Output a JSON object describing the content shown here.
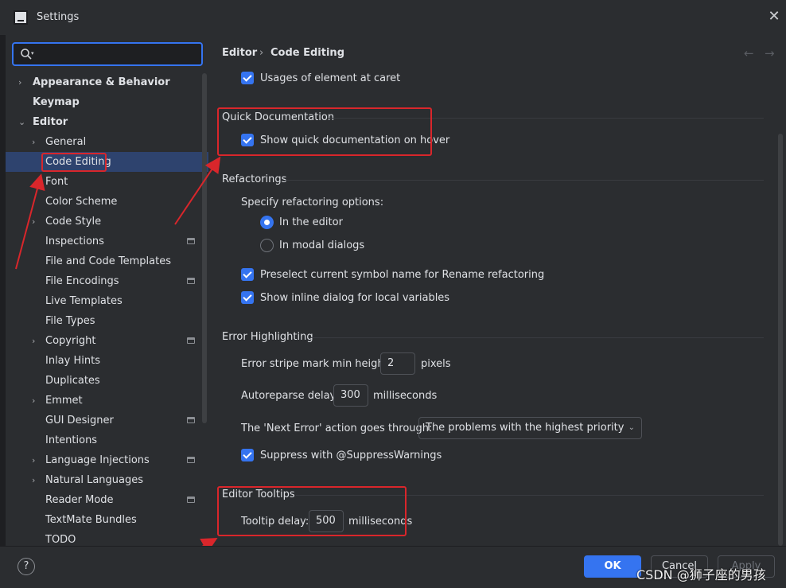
{
  "window": {
    "title": "Settings"
  },
  "sidebar": {
    "search_placeholder": "",
    "items": [
      {
        "label": "Appearance & Behavior"
      },
      {
        "label": "Keymap"
      },
      {
        "label": "Editor"
      },
      {
        "label": "General"
      },
      {
        "label": "Code Editing"
      },
      {
        "label": "Font"
      },
      {
        "label": "Color Scheme"
      },
      {
        "label": "Code Style"
      },
      {
        "label": "Inspections"
      },
      {
        "label": "File and Code Templates"
      },
      {
        "label": "File Encodings"
      },
      {
        "label": "Live Templates"
      },
      {
        "label": "File Types"
      },
      {
        "label": "Copyright"
      },
      {
        "label": "Inlay Hints"
      },
      {
        "label": "Duplicates"
      },
      {
        "label": "Emmet"
      },
      {
        "label": "GUI Designer"
      },
      {
        "label": "Intentions"
      },
      {
        "label": "Language Injections"
      },
      {
        "label": "Natural Languages"
      },
      {
        "label": "Reader Mode"
      },
      {
        "label": "TextMate Bundles"
      },
      {
        "label": "TODO"
      }
    ]
  },
  "breadcrumb": {
    "parent": "Editor",
    "separator": "›",
    "current": "Code Editing"
  },
  "nav": {
    "back": "←",
    "forward": "→"
  },
  "main": {
    "usages_at_caret": {
      "label": "Usages of element at caret",
      "checked": true
    },
    "quick_doc": {
      "title": "Quick Documentation",
      "show_on_hover": {
        "label": "Show quick documentation on hover",
        "checked": true
      }
    },
    "refactorings": {
      "title": "Refactorings",
      "specify_label": "Specify refactoring options:",
      "in_editor": {
        "label": "In the editor",
        "selected": true
      },
      "in_modal": {
        "label": "In modal dialogs",
        "selected": false
      },
      "preselect": {
        "label": "Preselect current symbol name for Rename refactoring",
        "checked": true
      },
      "inline_dialog": {
        "label": "Show inline dialog for local variables",
        "checked": true
      }
    },
    "error_highlighting": {
      "title": "Error Highlighting",
      "stripe_label": "Error stripe mark min height:",
      "stripe_value": "2",
      "stripe_unit": "pixels",
      "autoreparse_label": "Autoreparse delay:",
      "autoreparse_value": "300",
      "autoreparse_unit": "milliseconds",
      "next_error_label": "The 'Next Error' action goes through:",
      "next_error_value": "The problems with the highest priority",
      "suppress": {
        "label": "Suppress with @SuppressWarnings",
        "checked": true
      }
    },
    "tooltips": {
      "title": "Editor Tooltips",
      "delay_label": "Tooltip delay:",
      "delay_value": "500",
      "delay_unit": "milliseconds"
    }
  },
  "footer": {
    "help": "?",
    "ok": "OK",
    "cancel": "Cancel",
    "apply": "Apply"
  },
  "watermark": "CSDN @狮子座的男孩",
  "colors": {
    "accent": "#3574f0",
    "selection": "#2e436e",
    "annotation": "#d9262b",
    "background": "#2b2d30"
  }
}
